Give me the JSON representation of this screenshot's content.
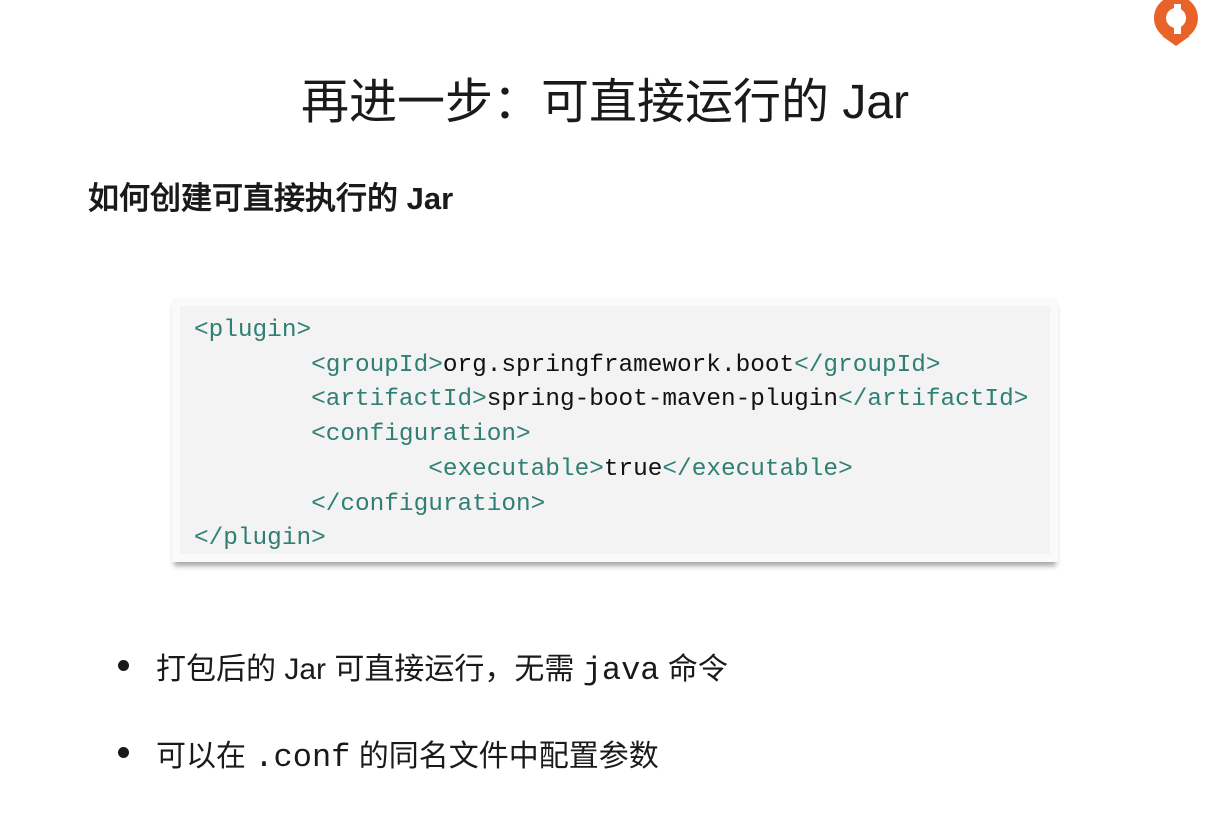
{
  "title": "再进一步：可直接运行的 Jar",
  "subtitle": "如何创建可直接执行的 Jar",
  "code": {
    "l1_tag": "<plugin>",
    "l2_open": "<groupId>",
    "l2_val": "org.springframework.boot",
    "l2_close": "</groupId>",
    "l3_open": "<artifactId>",
    "l3_val": "spring-boot-maven-plugin",
    "l3_close": "</artifactId>",
    "l4_tag": "<configuration>",
    "l5_open": "<executable>",
    "l5_val": "true",
    "l5_close": "</executable>",
    "l6_tag": "</configuration>",
    "l7_tag": "</plugin>"
  },
  "bullets": [
    {
      "before": "打包后的 Jar 可直接运行，无需 ",
      "code": "java",
      "after": " 命令"
    },
    {
      "before": "可以在 ",
      "code": ".conf",
      "after": " 的同名文件中配置参数"
    }
  ],
  "colors": {
    "tag": "#2f7f74",
    "logo": "#e8632a"
  },
  "logo_icon": "brand-logo-icon"
}
